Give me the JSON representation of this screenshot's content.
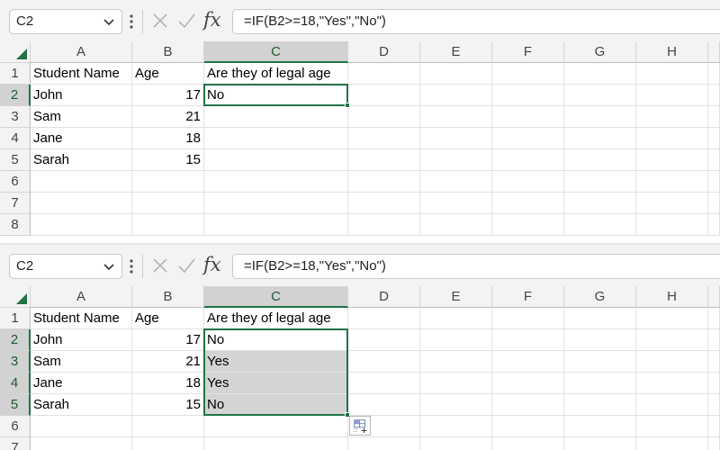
{
  "colors": {
    "accent": "#217346",
    "header_bg": "#f3f3f3",
    "selected_header_bg": "#d2d2d2",
    "fill_selected": "#d4d4d4",
    "gridline": "#e1e1e1"
  },
  "icons": {
    "name_box_dropdown": "chevron-down-icon",
    "more": "vertical-dots-icon",
    "cancel": "close-icon",
    "enter": "check-icon",
    "function": "fx-icon",
    "select_all": "select-all-triangle-icon",
    "quick_analysis": "quick-analysis-icon"
  },
  "columns": [
    "A",
    "B",
    "C",
    "D",
    "E",
    "F",
    "G",
    "H"
  ],
  "top": {
    "name_box": "C2",
    "fx_label": "fx",
    "formula": "=IF(B2>=18,\"Yes\",\"No\")",
    "row_numbers": [
      "1",
      "2",
      "3",
      "4",
      "5",
      "6",
      "7",
      "8"
    ],
    "rows": [
      [
        "Student Name",
        "Age",
        "Are they of legal age"
      ],
      [
        "John",
        "17",
        "No"
      ],
      [
        "Sam",
        "21",
        ""
      ],
      [
        "Jane",
        "18",
        ""
      ],
      [
        "Sarah",
        "15",
        ""
      ],
      [
        "",
        "",
        ""
      ],
      [
        "",
        "",
        ""
      ],
      [
        "",
        "",
        ""
      ]
    ]
  },
  "bottom": {
    "name_box": "C2",
    "fx_label": "fx",
    "formula": "=IF(B2>=18,\"Yes\",\"No\")",
    "row_numbers": [
      "1",
      "2",
      "3",
      "4",
      "5",
      "6",
      "7"
    ],
    "rows": [
      [
        "Student Name",
        "Age",
        "Are they of legal age"
      ],
      [
        "John",
        "17",
        "No"
      ],
      [
        "Sam",
        "21",
        "Yes"
      ],
      [
        "Jane",
        "18",
        "Yes"
      ],
      [
        "Sarah",
        "15",
        "No"
      ],
      [
        "",
        "",
        ""
      ],
      [
        "",
        "",
        ""
      ]
    ]
  }
}
